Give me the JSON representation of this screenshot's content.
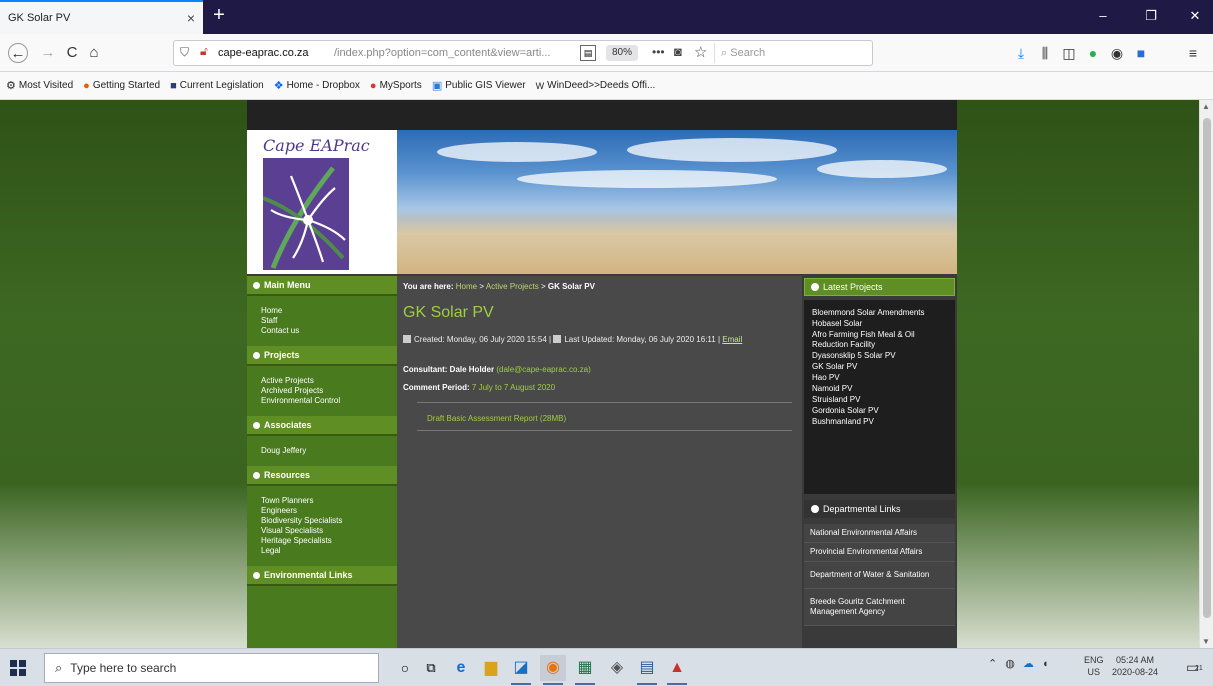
{
  "browser": {
    "tab_title": "GK Solar PV",
    "tab_close": "×",
    "new_tab": "+",
    "window_controls": {
      "minimize": "–",
      "maximize": "❐",
      "close": "✕"
    },
    "nav": {
      "back": "←",
      "forward": "→",
      "reload": "C",
      "home": "⌂"
    },
    "url_host": "cape-eaprac.co.za",
    "url_path": "/index.php?option=com_content&view=arti...",
    "zoom": "80%",
    "search_placeholder": "Search",
    "bookmarks": [
      {
        "icon": "gear-icon",
        "glyph": "⚙",
        "label": "Most Visited"
      },
      {
        "icon": "firefox-icon",
        "glyph": "●",
        "label": "Getting Started"
      },
      {
        "icon": "book-icon",
        "glyph": "■",
        "label": "Current Legislation"
      },
      {
        "icon": "dropbox-icon",
        "glyph": "❖",
        "label": "Home - Dropbox"
      },
      {
        "icon": "sports-icon",
        "glyph": "●",
        "label": "MySports"
      },
      {
        "icon": "map-icon",
        "glyph": "▣",
        "label": "Public GIS Viewer"
      },
      {
        "icon": "w-icon",
        "glyph": "W",
        "label": "WinDeed>>Deeds Offi..."
      }
    ]
  },
  "site": {
    "logo_text": "Cape EAPrac",
    "sidebar": [
      {
        "heading": "Main Menu",
        "links": [
          "Home",
          "Staff",
          "Contact us"
        ]
      },
      {
        "heading": "Projects",
        "links": [
          "Active Projects",
          "Archived Projects",
          "Environmental Control"
        ]
      },
      {
        "heading": "Associates",
        "links": [
          "Doug Jeffery"
        ]
      },
      {
        "heading": "Resources",
        "links": [
          "Town Planners",
          "Engineers",
          "Biodiversity Specialists",
          "Visual Specialists",
          "Heritage Specialists",
          "Legal"
        ]
      },
      {
        "heading": "Environmental Links",
        "links": []
      }
    ],
    "breadcrumb": {
      "label": "You are here:",
      "home": "Home",
      "sep1": " > ",
      "section": "Active Projects",
      "sep2": " > ",
      "current": "GK Solar PV"
    },
    "article": {
      "title": "GK Solar PV",
      "created": "Created: Monday, 06 July 2020 15:54",
      "separator": " | ",
      "updated": "Last Updated: Monday, 06 July 2020 16:11",
      "separator2": " | ",
      "email": "Email",
      "consultant_label": "Consultant: Dale Holder",
      "consultant_email": "(dale@cape-eaprac.co.za)",
      "comment_label": "Comment Period:",
      "comment_value": "7 July to 7 August 2020",
      "document_link": "Draft Basic Assessment Report (28MB)"
    },
    "latest_projects": {
      "heading": "Latest Projects",
      "items": [
        "Bloemmond Solar Amendments",
        "Hobasel Solar",
        "Afro Farming Fish Meal & Oil Reduction Facility",
        "Dyasonsklip 5 Solar PV",
        "GK Solar PV",
        "Hao PV",
        "Namoid PV",
        "Struisland PV",
        "Gordonia Solar PV",
        "Bushmanland PV"
      ]
    },
    "departmental_links": {
      "heading": "Departmental Links",
      "items": [
        "National Environmental Affairs",
        "Provincial Environmental Affairs",
        "Department of Water & Sanitation",
        "Breede Gouritz Catchment Management Agency"
      ]
    }
  },
  "taskbar": {
    "search_placeholder": "Type here to search",
    "language_top": "ENG",
    "language_bottom": "US",
    "time": "05:24 AM",
    "date": "2020-08-24",
    "notification_count": "21"
  }
}
